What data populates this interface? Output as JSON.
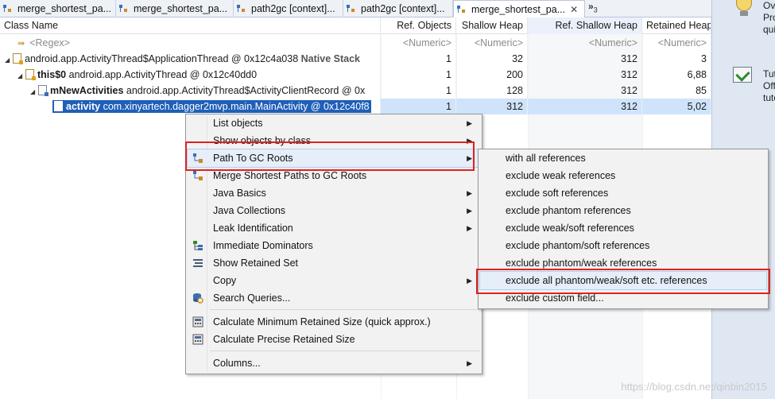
{
  "tabs": [
    {
      "label": "merge_shortest_pa..."
    },
    {
      "label": "merge_shortest_pa..."
    },
    {
      "label": "path2gc [context]..."
    },
    {
      "label": "path2gc [context]..."
    },
    {
      "label": "merge_shortest_pa..."
    }
  ],
  "tab_overflow": {
    "symbol": "»",
    "count": "3"
  },
  "columns": {
    "class_name": "Class Name",
    "ref_objects": "Ref. Objects",
    "shallow_heap": "Shallow Heap",
    "ref_shallow_heap": "Ref. Shallow Heap",
    "retained_heap": "Retained Heap"
  },
  "filter_row": {
    "regex": "<Regex>",
    "numeric1": "<Numeric>",
    "numeric2": "<Numeric>",
    "numeric3": "<Numeric>",
    "numeric4": "<Numeric>"
  },
  "rows": [
    {
      "field": "",
      "name": "android.app.ActivityThread$ApplicationThread @ 0x12c4a038",
      "suffix": "Native Stack",
      "ref_objects": "1",
      "shallow": "32",
      "ref_shallow": "312",
      "retained": "3"
    },
    {
      "field": "this$0",
      "name": "android.app.ActivityThread @ 0x12c40dd0",
      "suffix": "",
      "ref_objects": "1",
      "shallow": "200",
      "ref_shallow": "312",
      "retained": "6,88"
    },
    {
      "field": "mNewActivities",
      "name": "android.app.ActivityThread$ActivityClientRecord @ 0x",
      "suffix": "",
      "ref_objects": "1",
      "shallow": "128",
      "ref_shallow": "312",
      "retained": "85"
    },
    {
      "field": "activity",
      "name": "com.xinyartech.dagger2mvp.main.MainActivity @ 0x12c40f8",
      "suffix": "",
      "ref_objects": "1",
      "shallow": "312",
      "ref_shallow": "312",
      "retained": "5,02"
    }
  ],
  "context_menu": {
    "items": [
      {
        "label": "List objects"
      },
      {
        "label": "Show objects by class"
      },
      {
        "label": "Path To GC Roots"
      },
      {
        "label": "Merge Shortest Paths to GC Roots"
      },
      {
        "label": "Java Basics"
      },
      {
        "label": "Java Collections"
      },
      {
        "label": "Leak Identification"
      },
      {
        "label": "Immediate Dominators"
      },
      {
        "label": "Show Retained Set"
      },
      {
        "label": "Copy"
      },
      {
        "label": "Search Queries..."
      },
      {
        "label": "Calculate Minimum Retained Size (quick approx.)"
      },
      {
        "label": "Calculate Precise Retained Size"
      },
      {
        "label": "Columns..."
      }
    ]
  },
  "submenu": {
    "items": [
      {
        "label": "with all references"
      },
      {
        "label": "exclude weak references"
      },
      {
        "label": "exclude soft references"
      },
      {
        "label": "exclude phantom references"
      },
      {
        "label": "exclude weak/soft references"
      },
      {
        "label": "exclude phantom/soft references"
      },
      {
        "label": "exclude phantom/weak references"
      },
      {
        "label": "exclude all phantom/weak/soft etc. references"
      },
      {
        "label": "exclude custom field..."
      }
    ]
  },
  "right_panel": {
    "line1a": "Ov",
    "line1b": "Pro",
    "line1c": "qui",
    "line2a": "Tut",
    "line2b": "Off",
    "line2c": "tuto"
  },
  "watermark": "https://blog.csdn.net/qinbin2015",
  "colors": {
    "highlight_box": "#e02020",
    "selection": "#1f5fb8",
    "menu_hover": "#e5eef9"
  }
}
